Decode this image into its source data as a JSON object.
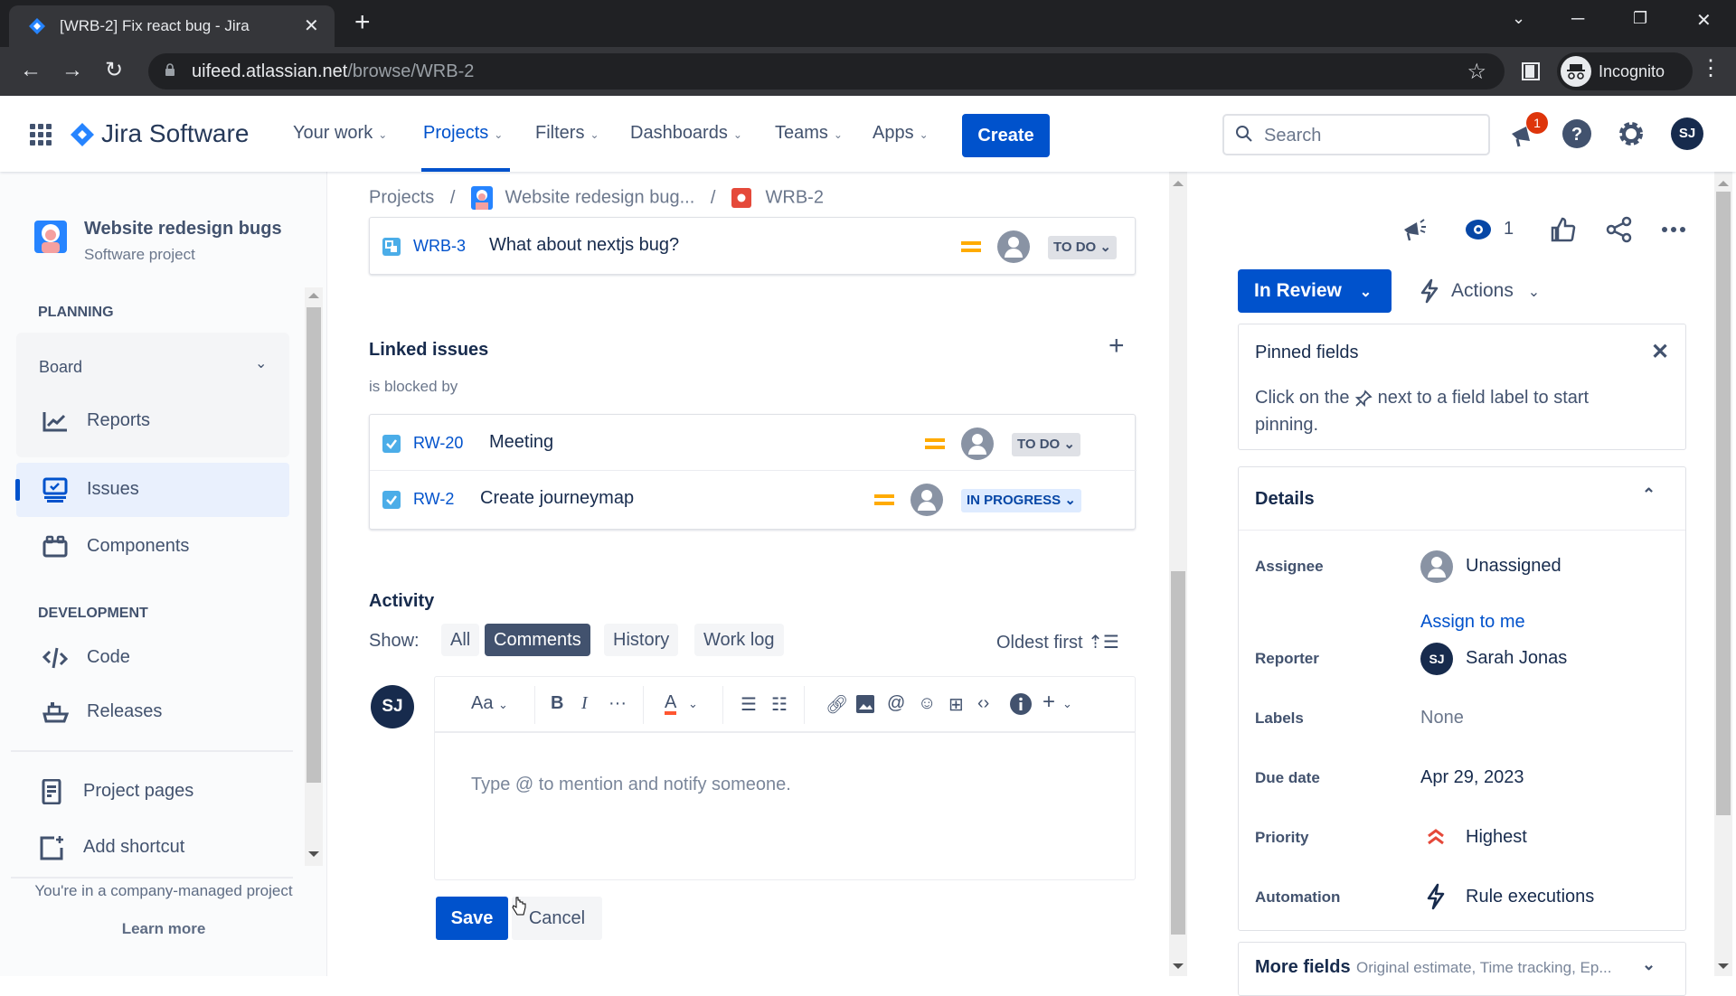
{
  "browser": {
    "tab_title": "[WRB-2] Fix react bug - Jira",
    "url_host": "uifeed.atlassian.net",
    "url_path": "/browse/WRB-2",
    "profile_label": "Incognito"
  },
  "topnav": {
    "product": "Jira Software",
    "items": [
      {
        "label": "Your work",
        "active": false
      },
      {
        "label": "Projects",
        "active": true
      },
      {
        "label": "Filters",
        "active": false
      },
      {
        "label": "Dashboards",
        "active": false
      },
      {
        "label": "Teams",
        "active": false
      },
      {
        "label": "Apps",
        "active": false
      }
    ],
    "create_label": "Create",
    "search_placeholder": "Search",
    "notification_count": "1",
    "user_initials": "SJ",
    "brand_color": "#0052cc"
  },
  "sidebar": {
    "project_name": "Website redesign bugs",
    "project_type": "Software project",
    "planning_heading": "PLANNING",
    "board_label": "Board",
    "reports_label": "Reports",
    "issues_label": "Issues",
    "components_label": "Components",
    "development_heading": "DEVELOPMENT",
    "code_label": "Code",
    "releases_label": "Releases",
    "project_pages_label": "Project pages",
    "add_shortcut_label": "Add shortcut",
    "footer_text": "You're in a company-managed project",
    "learn_more": "Learn more"
  },
  "main": {
    "breadcrumb": {
      "root": "Projects",
      "project": "Website redesign bug...",
      "issue": "WRB-2"
    },
    "child_issue": {
      "key": "WRB-3",
      "summary": "What about nextjs bug?",
      "priority": "Medium",
      "status": "TO DO"
    },
    "linked_issues": {
      "title": "Linked issues",
      "relation": "is blocked by",
      "items": [
        {
          "key": "RW-20",
          "summary": "Meeting",
          "priority": "Medium",
          "status": "TO DO"
        },
        {
          "key": "RW-2",
          "summary": "Create journeymap",
          "priority": "Medium",
          "status": "IN PROGRESS"
        }
      ]
    },
    "activity": {
      "title": "Activity",
      "show_label": "Show:",
      "filters": [
        "All",
        "Comments",
        "History",
        "Work log"
      ],
      "selected_filter": "Comments",
      "sort_label": "Oldest first",
      "commenter_initials": "SJ",
      "text_style_label": "Aa",
      "comment_placeholder": "Type @ to mention and notify someone.",
      "save_label": "Save",
      "cancel_label": "Cancel"
    }
  },
  "right_panel": {
    "watchers_count": "1",
    "status_label": "In Review",
    "actions_label": "Actions",
    "pinned": {
      "title": "Pinned fields",
      "text_before": "Click on the",
      "text_after": "next to a field label to start pinning."
    },
    "details": {
      "title": "Details",
      "assignee_label": "Assignee",
      "assignee_value": "Unassigned",
      "assign_to_me": "Assign to me",
      "reporter_label": "Reporter",
      "reporter_value": "Sarah Jonas",
      "reporter_initials": "SJ",
      "labels_label": "Labels",
      "labels_value": "None",
      "due_date_label": "Due date",
      "due_date_value": "Apr 29, 2023",
      "priority_label": "Priority",
      "priority_value": "Highest",
      "automation_label": "Automation",
      "automation_value": "Rule executions"
    },
    "more_fields": {
      "title": "More fields",
      "hint": "Original estimate, Time tracking, Ep..."
    }
  }
}
